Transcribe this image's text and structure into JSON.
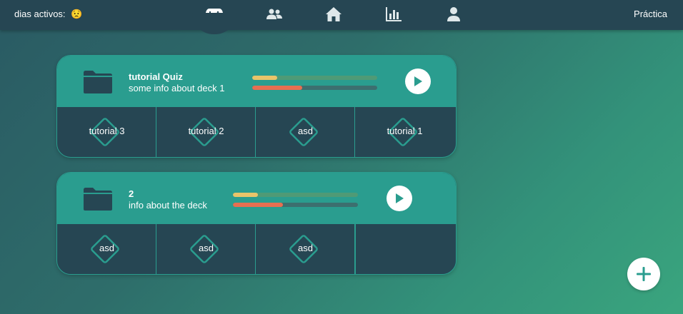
{
  "header": {
    "streak_label": "dias activos:",
    "streak_emoji": "😟",
    "mode_label": "Práctica",
    "nav": [
      {
        "icon": "gamepad-icon",
        "active": true
      },
      {
        "icon": "users-icon",
        "active": false
      },
      {
        "icon": "home-icon",
        "active": false
      },
      {
        "icon": "bar-chart-icon",
        "active": false
      },
      {
        "icon": "user-icon",
        "active": false
      }
    ]
  },
  "colors": {
    "dark": "#264653",
    "teal": "#2a9d8f",
    "yellow": "#e9c46a",
    "red": "#e76f51",
    "bar_track": "#4f9a76"
  },
  "decks": [
    {
      "title": "tutorial Quiz",
      "info": "some info about deck 1",
      "progress_yellow": 0.2,
      "progress_red": 0.4,
      "cards": [
        "tutorial 3",
        "tutorial 2",
        "asd",
        "tutorial 1"
      ]
    },
    {
      "title": "2",
      "info": "info about the deck",
      "progress_yellow": 0.2,
      "progress_red": 0.4,
      "cards": [
        "asd",
        "asd",
        "asd"
      ]
    }
  ]
}
